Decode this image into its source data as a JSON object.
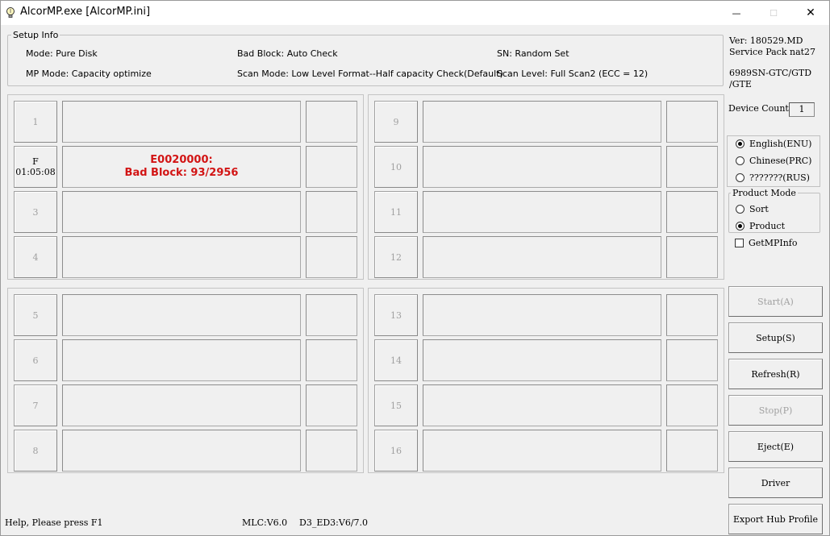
{
  "window": {
    "title": "AlcorMP.exe [AlcorMP.ini]",
    "min_glyph": "—",
    "max_glyph": "☐",
    "close_glyph": "✕"
  },
  "setup": {
    "legend": "Setup Info",
    "mode": "Mode: Pure Disk",
    "bad_block": "Bad Block: Auto Check",
    "sn": "SN: Random Set",
    "mp_mode": "MP Mode: Capacity optimize",
    "scan_mode": "Scan Mode: Low Level Format--Half capacity Check(Default)",
    "scan_level": "Scan Level: Full Scan2 (ECC = 12)"
  },
  "info": {
    "version": "Ver: 180529.MD",
    "service_pack": "Service Pack nat27",
    "model_line1": "6989SN-GTC/GTD",
    "model_line2": "/GTE",
    "device_count_label": "Device Count:",
    "device_count": "1"
  },
  "ports": [
    {
      "id": "1",
      "sub": "",
      "err1": "",
      "err2": "",
      "active": false
    },
    {
      "id": "F",
      "sub": "01:05:08",
      "err1": "E0020000:",
      "err2": "Bad Block: 93/2956",
      "active": true
    },
    {
      "id": "3",
      "sub": "",
      "err1": "",
      "err2": "",
      "active": false
    },
    {
      "id": "4",
      "sub": "",
      "err1": "",
      "err2": "",
      "active": false
    },
    {
      "id": "5",
      "sub": "",
      "err1": "",
      "err2": "",
      "active": false
    },
    {
      "id": "6",
      "sub": "",
      "err1": "",
      "err2": "",
      "active": false
    },
    {
      "id": "7",
      "sub": "",
      "err1": "",
      "err2": "",
      "active": false
    },
    {
      "id": "8",
      "sub": "",
      "err1": "",
      "err2": "",
      "active": false
    },
    {
      "id": "9",
      "sub": "",
      "err1": "",
      "err2": "",
      "active": false
    },
    {
      "id": "10",
      "sub": "",
      "err1": "",
      "err2": "",
      "active": false
    },
    {
      "id": "11",
      "sub": "",
      "err1": "",
      "err2": "",
      "active": false
    },
    {
      "id": "12",
      "sub": "",
      "err1": "",
      "err2": "",
      "active": false
    },
    {
      "id": "13",
      "sub": "",
      "err1": "",
      "err2": "",
      "active": false
    },
    {
      "id": "14",
      "sub": "",
      "err1": "",
      "err2": "",
      "active": false
    },
    {
      "id": "15",
      "sub": "",
      "err1": "",
      "err2": "",
      "active": false
    },
    {
      "id": "16",
      "sub": "",
      "err1": "",
      "err2": "",
      "active": false
    }
  ],
  "language": {
    "options": [
      {
        "label": "English(ENU)",
        "checked": true
      },
      {
        "label": "Chinese(PRC)",
        "checked": false
      },
      {
        "label": "???????(RUS)",
        "checked": false
      }
    ]
  },
  "product_mode": {
    "legend": "Product Mode",
    "options": [
      {
        "label": "Sort",
        "checked": false
      },
      {
        "label": "Product",
        "checked": true
      }
    ]
  },
  "get_mp_info": {
    "label": "GetMPInfo",
    "checked": false
  },
  "buttons": {
    "start": "Start(A)",
    "setup": "Setup(S)",
    "refresh": "Refresh(R)",
    "stop": "Stop(P)",
    "eject": "Eject(E)",
    "driver": "Driver",
    "export": "Export Hub Profile"
  },
  "statusbar": {
    "help": "Help, Please press F1",
    "mlc": "MLC:V6.0",
    "d3": "D3_ED3:V6/7.0"
  },
  "colors": {
    "error_text": "#d21414",
    "disabled_text": "#a0a0a0"
  }
}
